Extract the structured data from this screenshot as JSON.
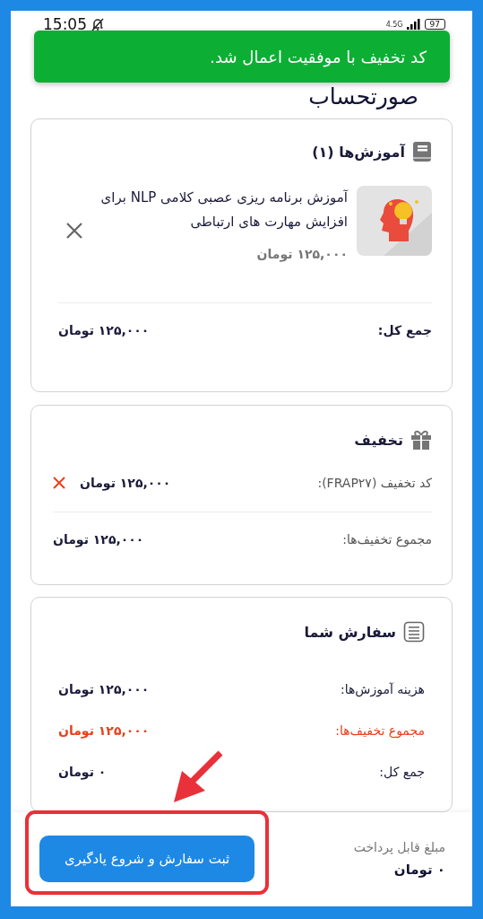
{
  "status_bar": {
    "time": "15:05",
    "network": "4.5G",
    "battery": "97"
  },
  "toast": {
    "message": "کد تخفیف با موفقیت اعمال شد."
  },
  "header": {
    "title": "صورتحساب"
  },
  "courses_card": {
    "title": "آموزش‌ها (۱)",
    "items": [
      {
        "title": "آموزش برنامه ریزی عصبی کلامی NLP برای افزایش مهارت های ارتباطی",
        "price": "۱۲۵,۰۰۰ تومان"
      }
    ],
    "total_label": "جمع کل:",
    "total_value": "۱۲۵,۰۰۰ تومان"
  },
  "discount_card": {
    "title": "تخفیف",
    "codes": [
      {
        "label": "کد تخفیف (FRAP۲۷):",
        "amount": "۱۲۵,۰۰۰ تومان"
      }
    ],
    "sum_label": "مجموع تخفیف‌ها:",
    "sum_value": "۱۲۵,۰۰۰ تومان"
  },
  "order_card": {
    "title": "سفارش شما",
    "rows": [
      {
        "kind": "normal",
        "label": "هزینه آموزش‌ها:",
        "value": "۱۲۵,۰۰۰ تومان"
      },
      {
        "kind": "discount",
        "label": "مجموع تخفیف‌ها:",
        "value": "۱۲۵,۰۰۰ تومان"
      },
      {
        "kind": "normal",
        "label": "جمع کل:",
        "value": "۰ تومان"
      }
    ]
  },
  "footer": {
    "payable_label": "مبلغ قابل پرداخت",
    "payable_value": "۰ تومان",
    "submit_button": "ثبت سفارش و شروع یادگیری"
  }
}
